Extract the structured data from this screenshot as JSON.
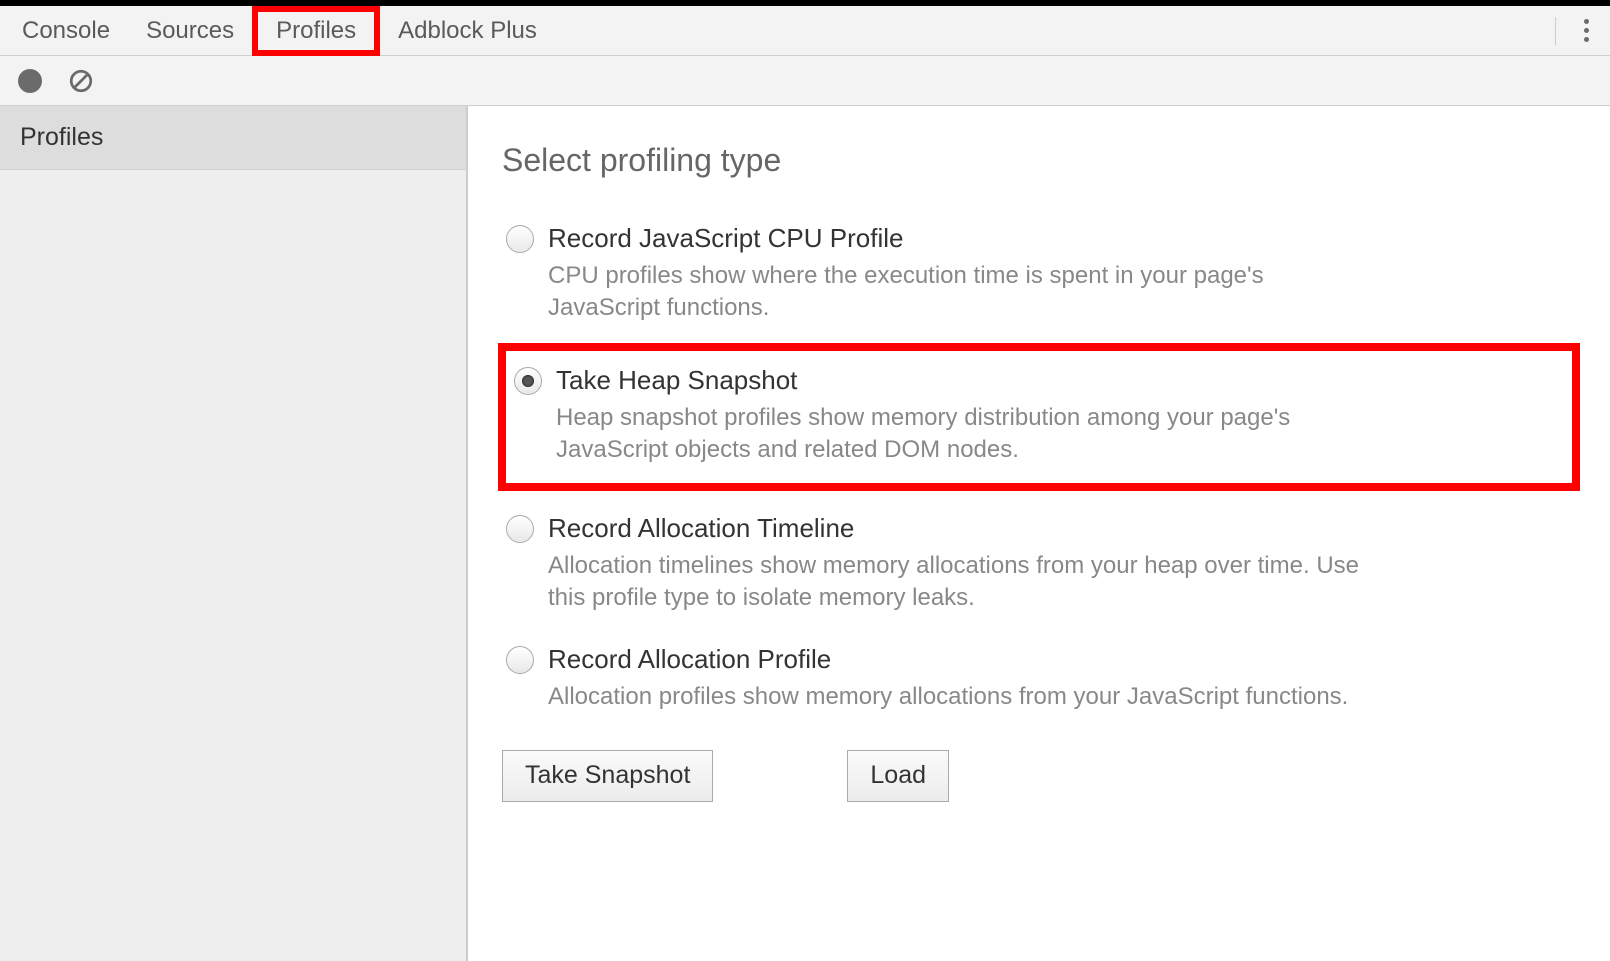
{
  "tabs": {
    "console": "Console",
    "sources": "Sources",
    "profiles": "Profiles",
    "adblock": "Adblock Plus"
  },
  "sidebar": {
    "header": "Profiles"
  },
  "main": {
    "heading": "Select profiling type",
    "options": [
      {
        "title": "Record JavaScript CPU Profile",
        "desc": "CPU profiles show where the execution time is spent in your page's JavaScript functions.",
        "selected": false
      },
      {
        "title": "Take Heap Snapshot",
        "desc": "Heap snapshot profiles show memory distribution among your page's JavaScript objects and related DOM nodes.",
        "selected": true
      },
      {
        "title": "Record Allocation Timeline",
        "desc": "Allocation timelines show memory allocations from your heap over time. Use this profile type to isolate memory leaks.",
        "selected": false
      },
      {
        "title": "Record Allocation Profile",
        "desc": "Allocation profiles show memory allocations from your JavaScript functions.",
        "selected": false
      }
    ],
    "buttons": {
      "primary": "Take Snapshot",
      "load": "Load"
    }
  }
}
